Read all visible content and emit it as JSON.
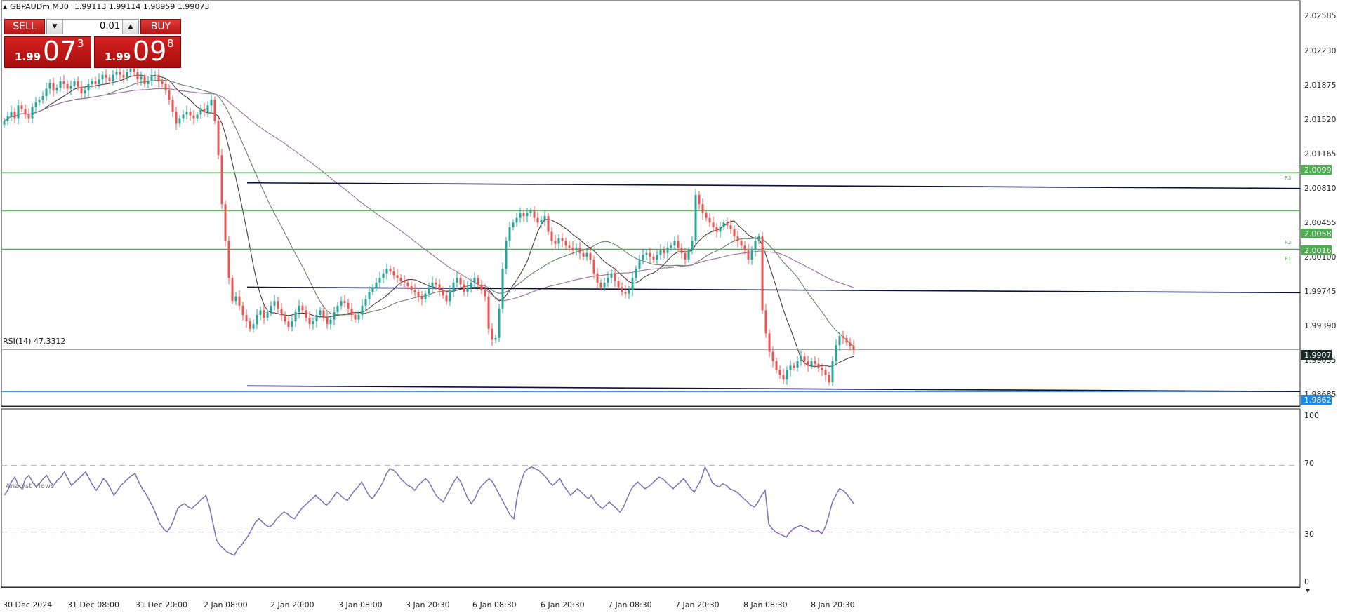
{
  "header": {
    "symbol": "GBPAUDm,M30",
    "ohlc": "1.99113 1.99114 1.98959 1.99073"
  },
  "trade_panel": {
    "sell_label": "SELL",
    "buy_label": "BUY",
    "lot_value": "0.01",
    "sell_price": {
      "prefix": "1.99",
      "big": "07",
      "sup": "3"
    },
    "buy_price": {
      "prefix": "1.99",
      "big": "09",
      "sup": "8"
    }
  },
  "price_axis": {
    "ticks": [
      "2.02585",
      "2.02230",
      "2.01875",
      "2.01520",
      "2.01165",
      "2.00810",
      "2.00455",
      "2.00100",
      "1.99745",
      "1.99390",
      "1.99035",
      "1.98685"
    ],
    "badges": [
      {
        "label": "2.00990",
        "kind": "green"
      },
      {
        "label": "2.00580",
        "kind": "green"
      },
      {
        "label": "2.00160",
        "kind": "green"
      },
      {
        "label": "1.99073",
        "kind": "current"
      },
      {
        "label": "1.98620",
        "kind": "blue"
      }
    ],
    "level_tags": [
      "R3",
      "R2",
      "R1"
    ]
  },
  "rsi": {
    "title": "RSI(14) 47.3312",
    "axis_ticks": [
      "100",
      "70",
      "30",
      "0"
    ]
  },
  "time_axis": {
    "labels": [
      "30 Dec 2024",
      "31 Dec 08:00",
      "31 Dec 20:00",
      "2 Jan 08:00",
      "2 Jan 20:00",
      "3 Jan 08:00",
      "3 Jan 20:30",
      "6 Jan 08:30",
      "6 Jan 20:30",
      "7 Jan 08:30",
      "7 Jan 20:30",
      "8 Jan 08:30",
      "8 Jan 20:30"
    ]
  },
  "footer": {
    "analyst_views": "Analyst Views"
  },
  "colors": {
    "bull": "#26a69a",
    "bear": "#ef5350",
    "support_resistance": "#4caf50",
    "trendline": "#0b1040",
    "ma_fast": "#4a3a3a",
    "ma_mid": "#6a7f6a",
    "ma_slow": "#9b6fa0",
    "rsi_line": "#7b6fb8",
    "current_badge": "#1c2a2a",
    "blue_badge": "#1e88e5"
  },
  "chart_data": {
    "type": "candlestick",
    "symbol": "GBPAUDm",
    "timeframe": "M30",
    "ylim": [
      1.985,
      2.028
    ],
    "rsi_ylim": [
      0,
      100
    ],
    "rsi_levels": [
      70,
      30
    ],
    "closes": [
      2.0155,
      2.016,
      2.0165,
      2.0158,
      2.0172,
      2.0168,
      2.0162,
      2.0158,
      2.017,
      2.0175,
      2.0178,
      2.0182,
      2.019,
      2.0196,
      2.0188,
      2.0191,
      2.0198,
      2.0195,
      2.019,
      2.0193,
      2.0198,
      2.0192,
      2.0185,
      2.0188,
      2.0195,
      2.0198,
      2.0195,
      2.02,
      2.0205,
      2.0202,
      2.0198,
      2.0205,
      2.0208,
      2.0205,
      2.0202,
      2.0208,
      2.0212,
      2.0208,
      2.02,
      2.0203,
      2.0195,
      2.0198,
      2.0205,
      2.0205,
      2.0198,
      2.0195,
      2.0188,
      2.0178,
      2.0165,
      2.0152,
      2.0158,
      2.0162,
      2.0165,
      2.0161,
      2.0158,
      2.0162,
      2.0168,
      2.0165,
      2.0172,
      2.0178,
      2.0155,
      2.0118,
      2.0065,
      2.0025,
      1.9985,
      1.996,
      1.9965,
      1.9955,
      1.9945,
      1.9938,
      1.993,
      1.9935,
      1.9945,
      1.995,
      1.9942,
      1.9948,
      1.9955,
      1.996,
      1.9952,
      1.9945,
      1.9938,
      1.9932,
      1.9938,
      1.9948,
      1.9955,
      1.995,
      1.9942,
      1.9935,
      1.9938,
      1.9945,
      1.995,
      1.9942,
      1.9935,
      1.994,
      1.9948,
      1.9955,
      1.996,
      1.9958,
      1.9952,
      1.9945,
      1.994,
      1.9945,
      1.9955,
      1.9962,
      1.997,
      1.9975,
      1.998,
      1.9985,
      1.999,
      1.9995,
      1.9992,
      1.9988,
      1.9985,
      1.9982,
      1.998,
      1.9976,
      1.9972,
      1.997,
      1.9965,
      1.9962,
      1.9968,
      1.9975,
      1.998,
      1.9978,
      1.9972,
      1.9966,
      1.996,
      1.997,
      1.998,
      1.9985,
      1.9978,
      1.997,
      1.9975,
      1.998,
      1.9985,
      1.9978,
      1.9972,
      1.9965,
      1.993,
      1.9918,
      1.992,
      1.9952,
      1.9995,
      2.0025,
      2.004,
      2.0045,
      2.005,
      2.0055,
      2.0052,
      2.0055,
      2.0058,
      2.005,
      2.0045,
      2.0048,
      2.0052,
      2.0035,
      2.0025,
      2.0022,
      2.0028,
      2.0025,
      2.002,
      2.0018,
      2.0015,
      2.0018,
      2.0012,
      2.0008,
      2.0012,
      2.0005,
      1.999,
      1.998,
      1.9975,
      1.998,
      1.9985,
      1.999,
      1.9982,
      1.9975,
      1.997,
      1.9968,
      1.9972,
      1.9985,
      1.9995,
      2.0005,
      2.001,
      2.0012,
      2.0008,
      2.0005,
      2.001,
      2.0015,
      2.0012,
      2.0018,
      2.002,
      2.0025,
      2.0018,
      2.0012,
      2.0005,
      2.0015,
      2.0025,
      2.0075,
      2.0065,
      2.0055,
      2.005,
      2.0045,
      2.004,
      2.0035,
      2.004,
      2.0045,
      2.0042,
      2.0038,
      2.003,
      2.0025,
      2.002,
      2.0015,
      2.0005,
      2.0015,
      2.0025,
      2.003,
      1.995,
      1.9925,
      1.9905,
      1.9895,
      1.9885,
      1.988,
      1.9875,
      1.9885,
      1.989,
      1.9888,
      1.9895,
      1.99,
      1.9895,
      1.989,
      1.9895,
      1.9892,
      1.9888,
      1.9885,
      1.988,
      1.9872,
      1.9895,
      1.9912,
      1.9922,
      1.992,
      1.9915,
      1.9911,
      1.9907
    ],
    "rsi": [
      52,
      55,
      60,
      63,
      58,
      56,
      62,
      64,
      60,
      57,
      59,
      62,
      64,
      60,
      58,
      61,
      63,
      66,
      62,
      58,
      60,
      62,
      64,
      66,
      62,
      58,
      55,
      58,
      62,
      60,
      56,
      52,
      55,
      58,
      60,
      62,
      64,
      65,
      60,
      56,
      53,
      49,
      45,
      40,
      35,
      32,
      30,
      33,
      38,
      44,
      46,
      47,
      45,
      44,
      46,
      48,
      50,
      52,
      45,
      35,
      25,
      22,
      20,
      18,
      17,
      16,
      20,
      22,
      25,
      28,
      32,
      36,
      38,
      36,
      34,
      33,
      35,
      38,
      40,
      42,
      41,
      39,
      38,
      41,
      44,
      46,
      48,
      50,
      52,
      50,
      48,
      46,
      48,
      51,
      54,
      52,
      50,
      49,
      52,
      55,
      57,
      60,
      56,
      52,
      50,
      53,
      56,
      60,
      65,
      68,
      67,
      65,
      62,
      60,
      58,
      57,
      55,
      58,
      60,
      62,
      60,
      56,
      52,
      50,
      48,
      52,
      56,
      60,
      63,
      60,
      55,
      50,
      47,
      50,
      55,
      58,
      60,
      62,
      60,
      56,
      52,
      48,
      44,
      40,
      38,
      52,
      60,
      66,
      68,
      69,
      68,
      67,
      65,
      63,
      60,
      58,
      60,
      62,
      58,
      55,
      52,
      54,
      56,
      54,
      52,
      50,
      52,
      48,
      46,
      44,
      46,
      48,
      46,
      44,
      42,
      45,
      50,
      55,
      58,
      60,
      58,
      56,
      57,
      59,
      61,
      63,
      62,
      60,
      58,
      56,
      58,
      60,
      62,
      59,
      56,
      54,
      58,
      62,
      69,
      65,
      60,
      58,
      57,
      59,
      58,
      56,
      55,
      54,
      52,
      50,
      48,
      46,
      45,
      48,
      52,
      55,
      35,
      32,
      30,
      29,
      28,
      27,
      30,
      32,
      33,
      34,
      33,
      32,
      31,
      30,
      31,
      29,
      33,
      40,
      48,
      52,
      56,
      55,
      53,
      50,
      47
    ],
    "levels": [
      {
        "name": "R3",
        "value": 2.0099
      },
      {
        "name": "R2",
        "value": 2.0058
      },
      {
        "name": "R1",
        "value": 2.0016
      },
      {
        "name": "current",
        "value": 1.99073
      },
      {
        "name": "support",
        "value": 1.9862
      }
    ]
  }
}
